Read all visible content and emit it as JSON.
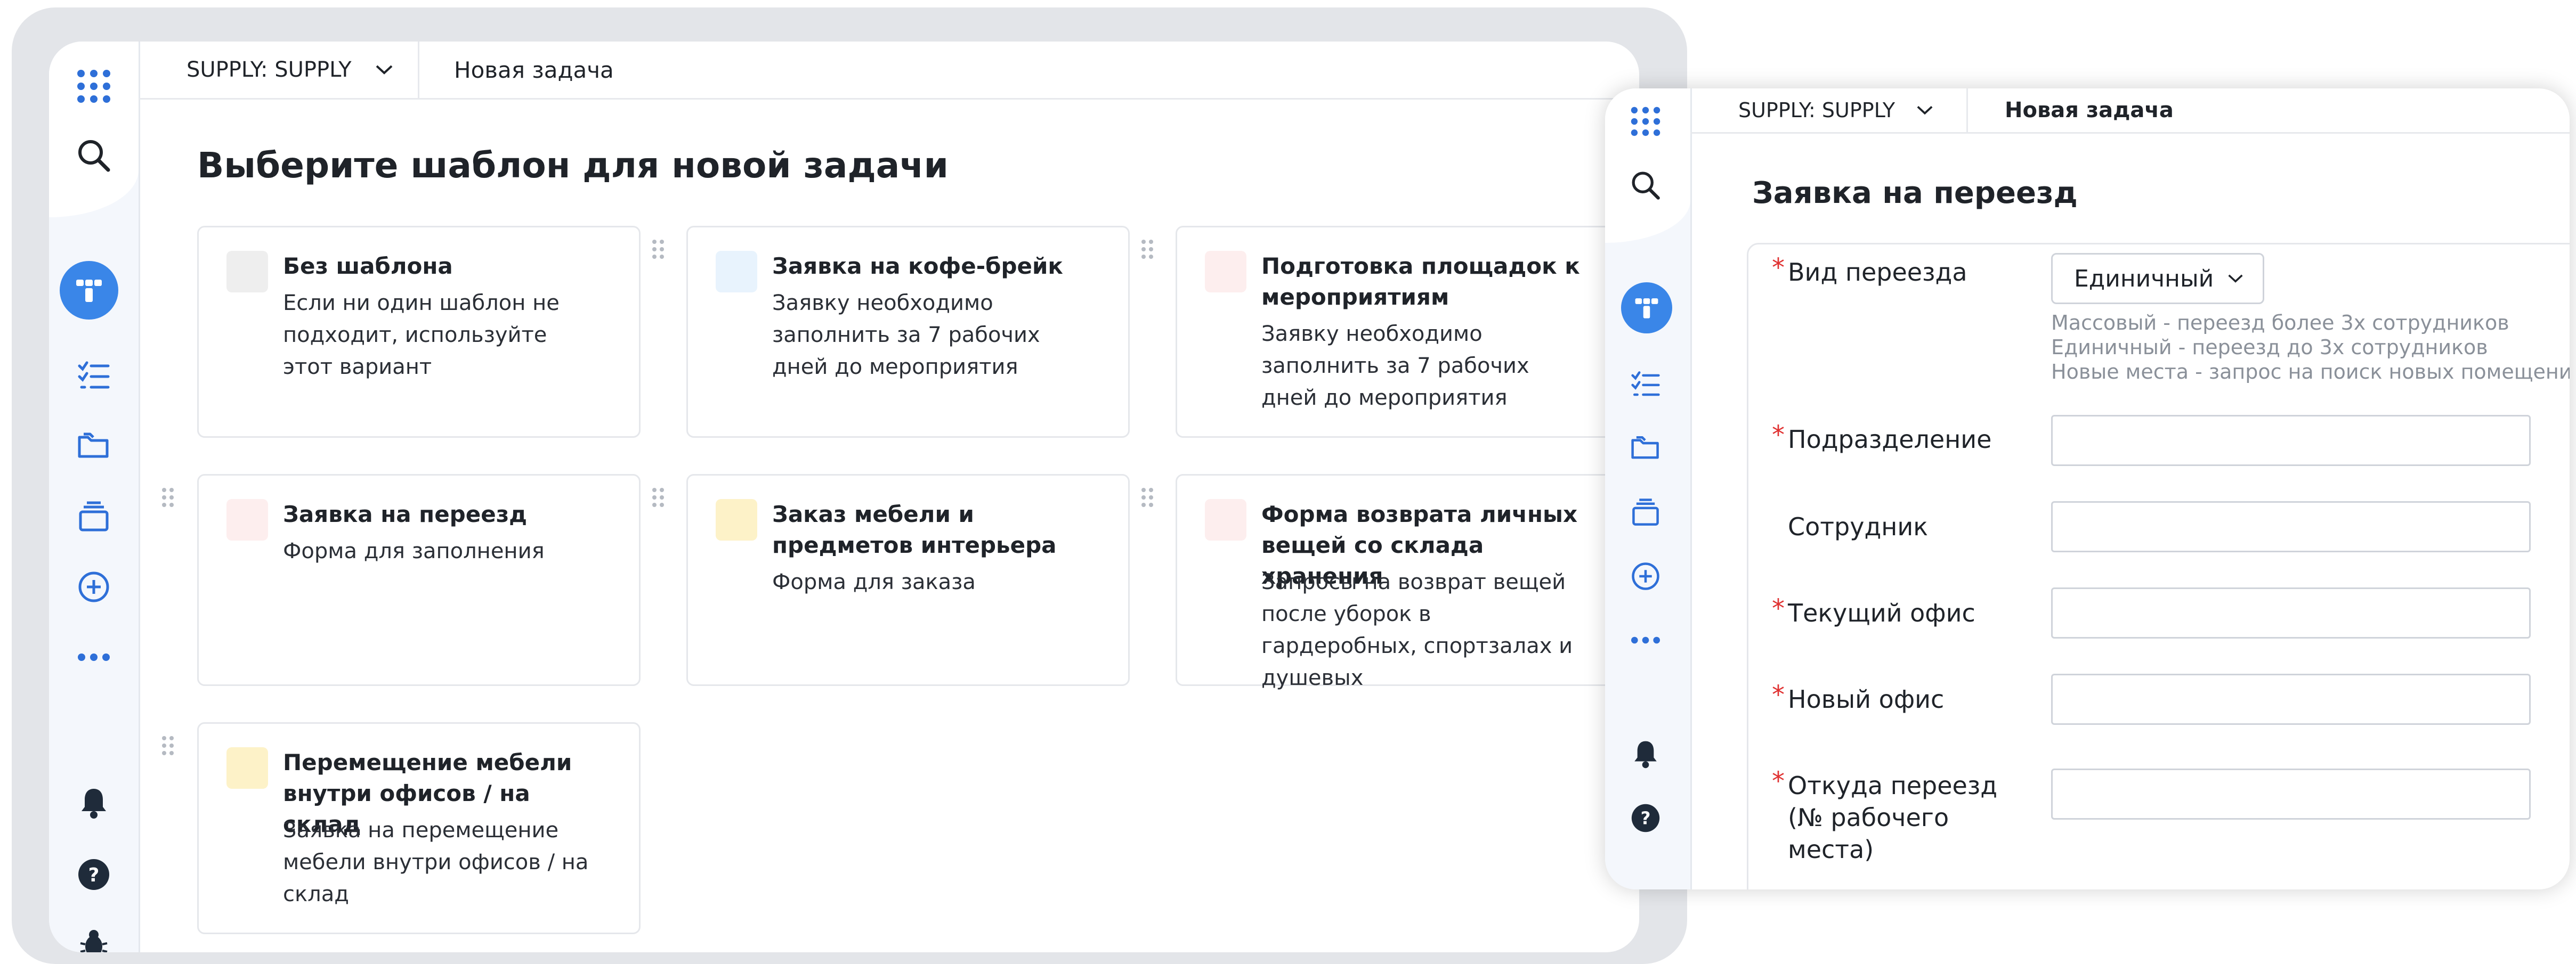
{
  "left_screen": {
    "queue_selector": "SUPPLY: SUPPLY",
    "breadcrumb": "Новая задача",
    "heading": "Выберите шаблон для новой задачи",
    "templates": [
      {
        "title": "Без шаблона",
        "description": "Если ни один шаблон не подходит, используйте этот вариант",
        "color": "#eeeeee"
      },
      {
        "title": "Заявка на кофе-брейк",
        "description": "Заявку необходимо заполнить за 7 рабочих дней до мероприятия",
        "color": "#e8f3fd"
      },
      {
        "title": "Подготовка площадок к мероприятиям",
        "description": "Заявку необходимо заполнить за 7 рабочих дней до мероприятия",
        "color": "#fdeeee"
      },
      {
        "title": "Заявка на переезд",
        "description": "Форма для заполнения",
        "color": "#fdeeee"
      },
      {
        "title": "Заказ мебели и предметов интерьера",
        "description": "Форма для заказа",
        "color": "#fdf2c8"
      },
      {
        "title": "Форма возврата личных вещей со склада хранения",
        "description": "Запросы на возврат вещей после уборок в гардеробных, спортзалах и душевых",
        "color": "#fdeeee"
      },
      {
        "title": "Перемещение мебели внутри офисов / на склад",
        "description": "Заявка на перемещение мебели внутри офисов / на склад",
        "color": "#fdf2c8"
      }
    ]
  },
  "right_screen": {
    "queue_selector": "SUPPLY: SUPPLY",
    "breadcrumb": "Новая задача",
    "form_title": "Заявка на переезд",
    "fields": {
      "move_type": {
        "label": "Вид переезда",
        "value": "Единичный",
        "required": true
      },
      "department": {
        "label": "Подразделение",
        "value": "",
        "required": true
      },
      "employee": {
        "label": "Сотрудник",
        "value": "",
        "required": false
      },
      "current_office": {
        "label": "Текущий офис",
        "value": "",
        "required": true
      },
      "new_office": {
        "label": "Новый офис",
        "value": "",
        "required": true
      },
      "from_workplace": {
        "label": "Откуда переезд (№ рабочего места)",
        "value": "",
        "required": true
      }
    },
    "move_type_hints": [
      "Массовый - переезд более 3х сотрудников",
      "Единичный - переезд до 3х сотрудников",
      "Новые места - запрос на поиск новых помещений"
    ]
  },
  "sidebar_icons": [
    "apps-grid-icon",
    "search-icon",
    "tracker-logo-icon",
    "tasks-list-icon",
    "folders-icon",
    "boards-icon",
    "add-circle-icon",
    "more-icon",
    "bell-icon",
    "help-icon",
    "bug-icon"
  ],
  "colors": {
    "accent": "#3a86e8",
    "required": "#e03131",
    "sidebar_bg": "#f4f7fc",
    "frame": "#e3e5e9"
  }
}
